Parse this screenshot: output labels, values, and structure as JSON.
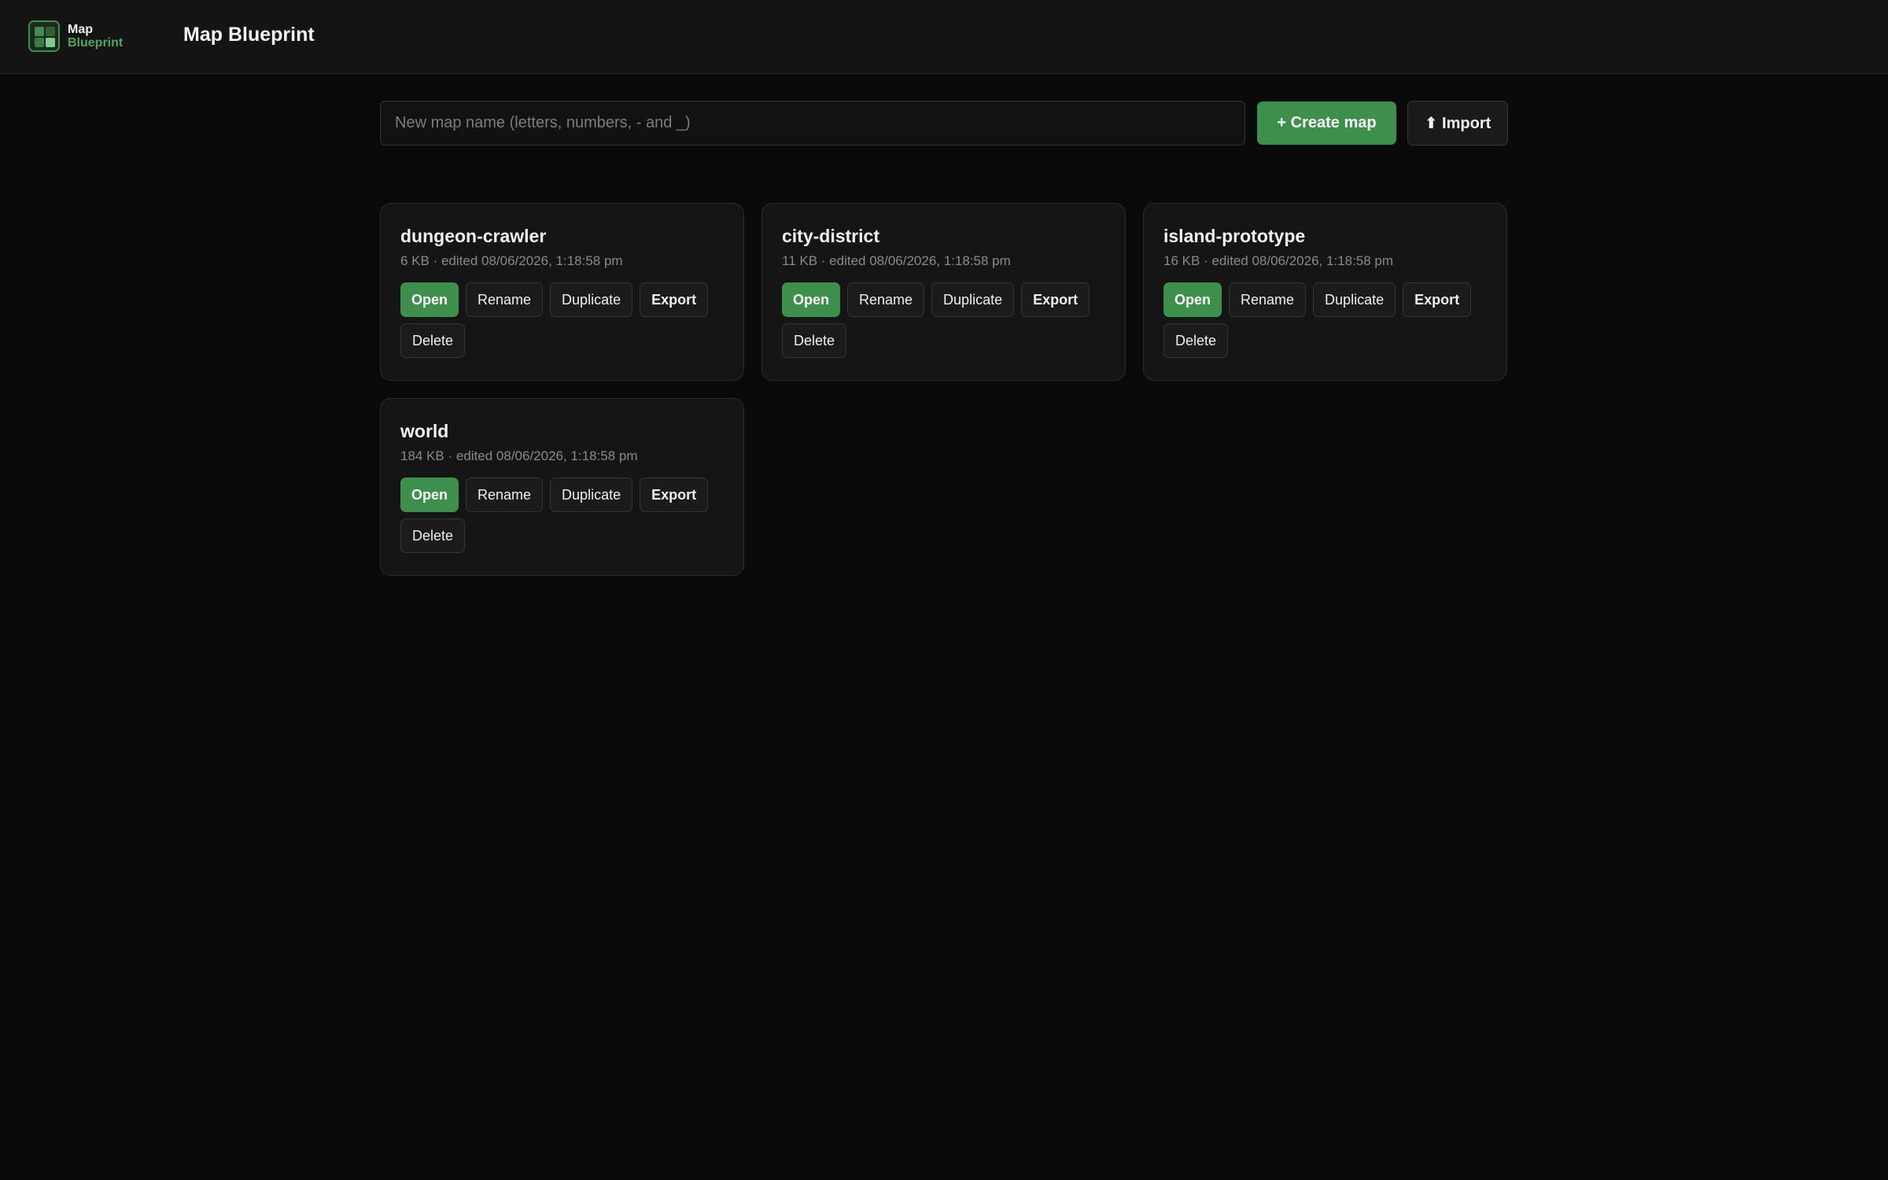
{
  "header": {
    "logo_line1": "Map",
    "logo_line2": "Blueprint",
    "title": "Map Blueprint"
  },
  "toolbar": {
    "name_placeholder": "New map name (letters, numbers, - and _)",
    "name_value": "",
    "create_label": "+ Create map",
    "import_label": "⬆ Import"
  },
  "card_actions": {
    "open": "Open",
    "rename": "Rename",
    "duplicate": "Duplicate",
    "export": "Export",
    "delete": "Delete"
  },
  "maps": [
    {
      "name": "dungeon-crawler",
      "meta": "6 KB · edited 08/06/2026, 1:18:58 pm"
    },
    {
      "name": "city-district",
      "meta": "11 KB · edited 08/06/2026, 1:18:58 pm"
    },
    {
      "name": "island-prototype",
      "meta": "16 KB · edited 08/06/2026, 1:18:58 pm"
    },
    {
      "name": "world",
      "meta": "184 KB · edited 08/06/2026, 1:18:58 pm"
    }
  ],
  "colors": {
    "accent": "#3d8f4c",
    "background": "#0a0a0a",
    "header": "#141414",
    "card": "#151515"
  },
  "icons": {
    "logo": "grid-logo-icon",
    "import": "upload-arrow-icon"
  }
}
